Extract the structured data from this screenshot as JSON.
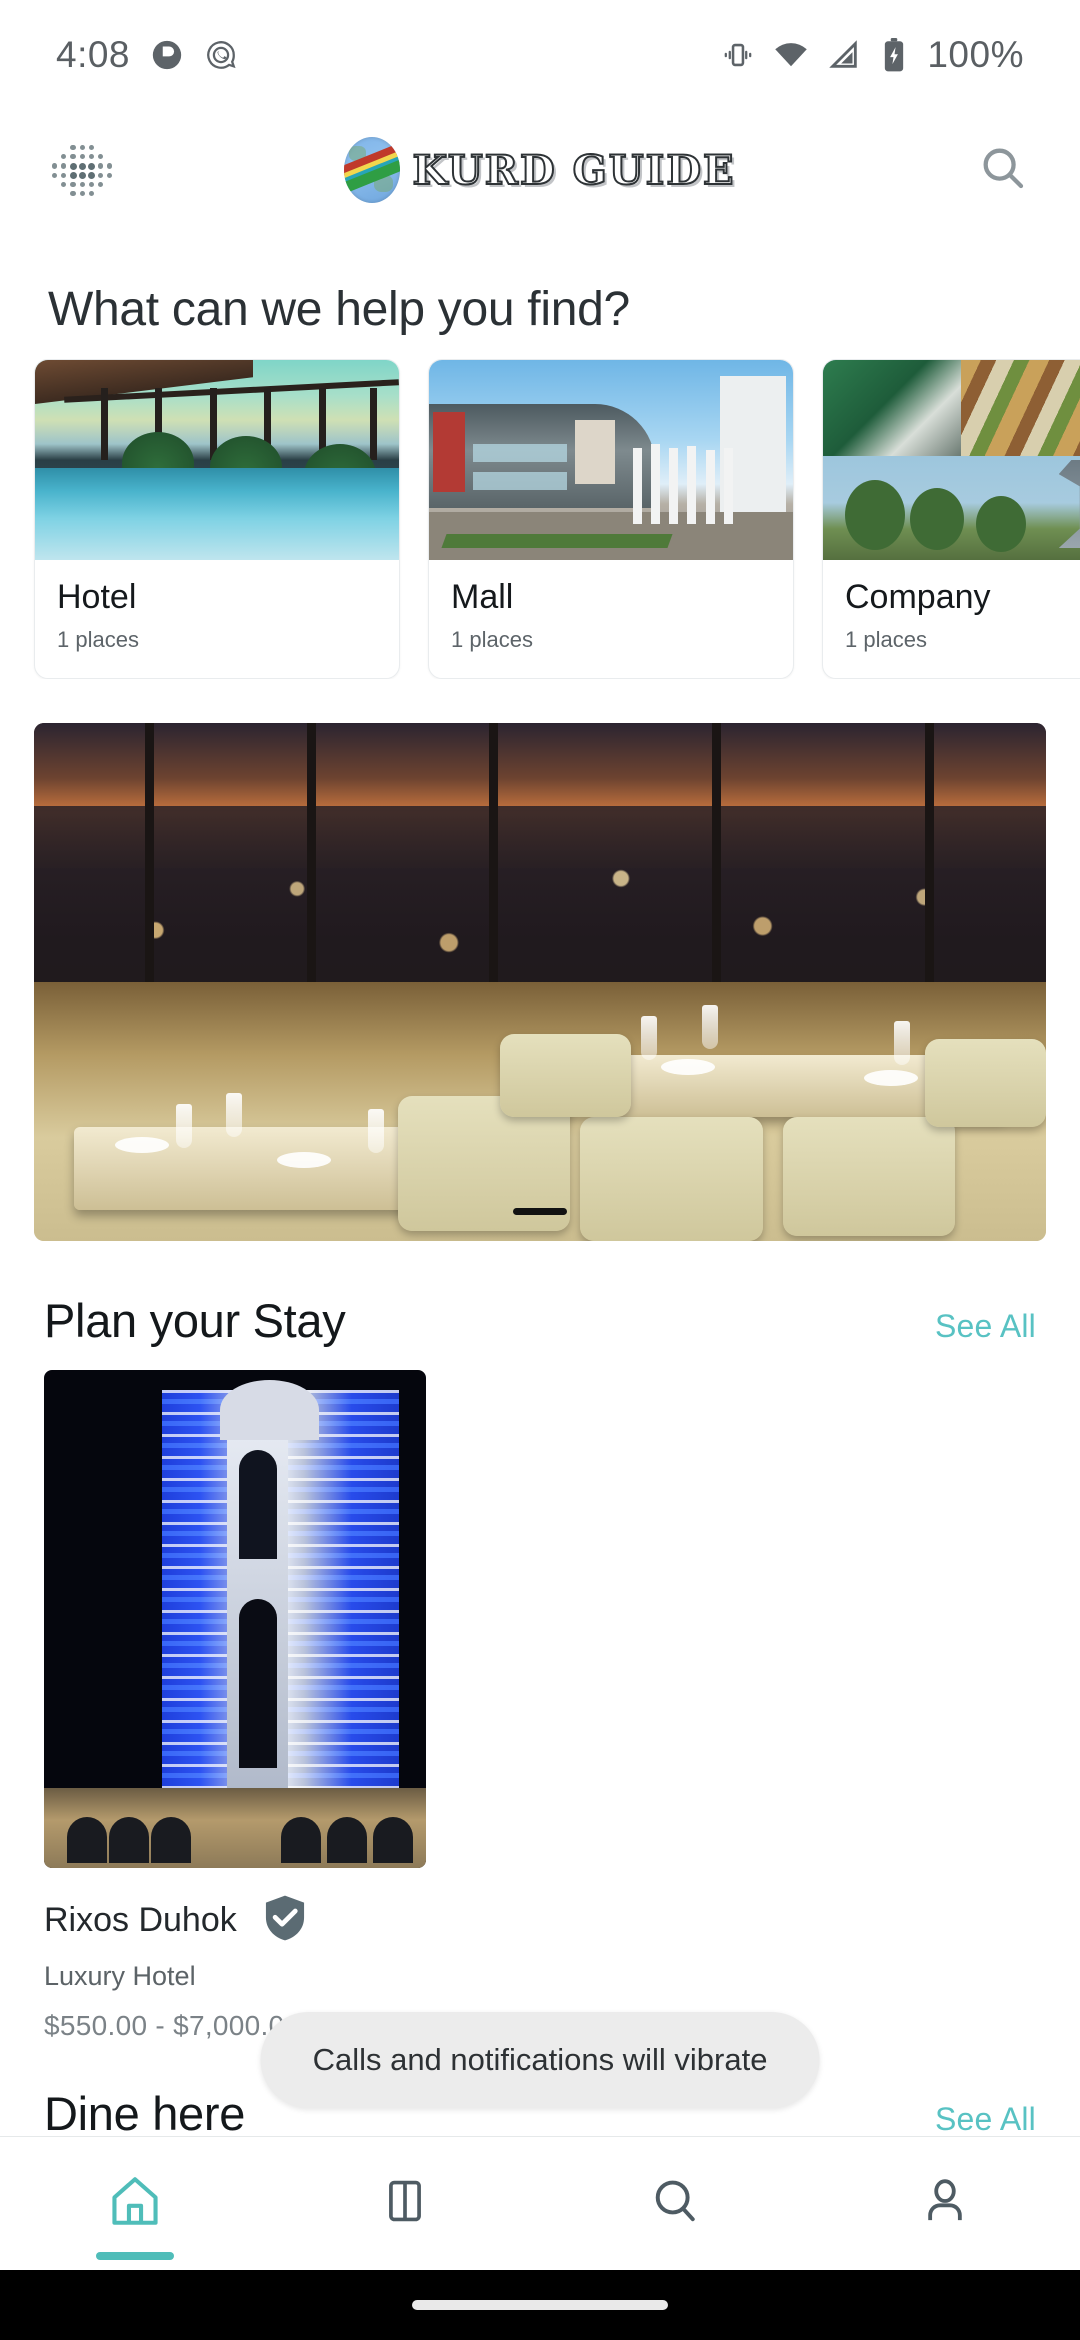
{
  "status_bar": {
    "time": "4:08",
    "battery_text": "100%",
    "icons": [
      "dnd-icon",
      "call-app-icon",
      "vibrate-icon",
      "wifi-icon",
      "cellular-signal-icon",
      "battery-charging-icon"
    ]
  },
  "app_bar": {
    "menu_icon": "dot-grid-menu-icon",
    "brand_name": "KURD GUIDE",
    "logo_icon": "globe-logo-icon",
    "search_icon": "search-icon"
  },
  "find_section": {
    "heading": "What can we help you find?",
    "categories": [
      {
        "title": "Hotel",
        "places": "1 places",
        "image": "rooftop-pool-photo"
      },
      {
        "title": "Mall",
        "places": "1 places",
        "image": "shopping-mall-exterior-photo"
      },
      {
        "title": "Company",
        "places": "1 places",
        "image": "kurdistan-collage-photo"
      }
    ]
  },
  "banner": {
    "image": "fine-dining-restaurant-city-view-photo",
    "indicator": "carousel-page-indicator"
  },
  "stay_section": {
    "title": "Plan your Stay",
    "see_all": "See All",
    "places": [
      {
        "name": "Rixos Duhok",
        "category": "Luxury Hotel",
        "price_range": "$550.00  -  $7,000.00",
        "verified": true,
        "image": "rixos-duhok-night-tower-photo"
      }
    ]
  },
  "dine_section": {
    "title": "Dine here",
    "see_all": "See All"
  },
  "toast": {
    "message": "Calls and notifications will vibrate"
  },
  "bottom_nav": {
    "items": [
      {
        "name": "home",
        "icon": "home-icon",
        "active": true
      },
      {
        "name": "bookings",
        "icon": "columns-icon",
        "active": false
      },
      {
        "name": "search",
        "icon": "search-icon",
        "active": false
      },
      {
        "name": "profile",
        "icon": "person-icon",
        "active": false
      }
    ]
  },
  "colors": {
    "accent_teal": "#4fbdb9",
    "see_all_teal": "#58c2c3",
    "text_primary": "#15191c",
    "text_secondary": "#5d6469",
    "price_text": "#7b8287",
    "verified_shield": "#5b6b73",
    "status_bar_text": "#5a5f63",
    "card_border": "#e9ecee",
    "toast_bg": "#ececec"
  }
}
